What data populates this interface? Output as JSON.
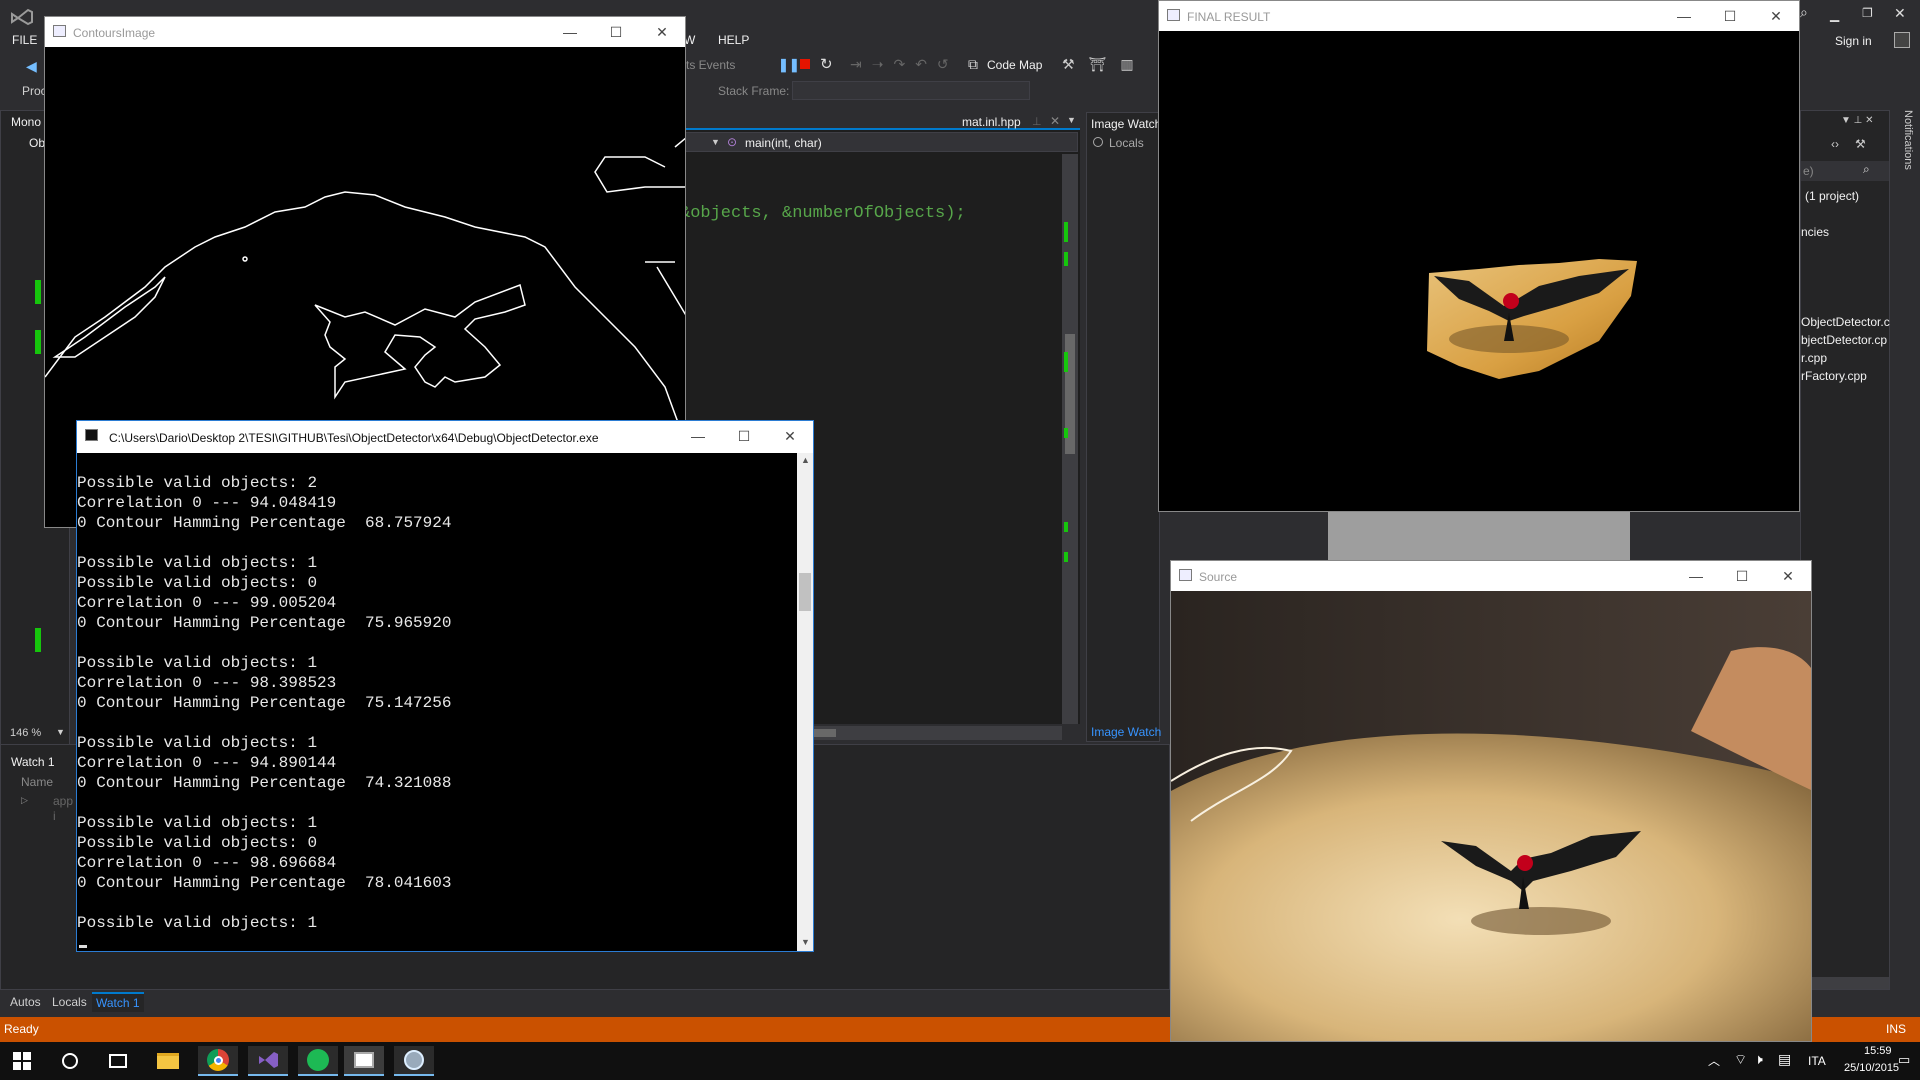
{
  "vs": {
    "menu": [
      "FILE",
      "W",
      "HELP"
    ],
    "toolbar": {
      "events": "ts Events",
      "code_map": "Code Map",
      "stack_frame_label": "Stack Frame:",
      "project_label": "Proc"
    },
    "left_panel": {
      "tab": "Mono",
      "item": "Ob",
      "zoom": "146 %"
    },
    "editor": {
      "tab": "mat.inl.hpp",
      "function_dropdown": "main(int, char)",
      "code_line": "&objects, &numberOfObjects);"
    },
    "image_watch": {
      "title": "Image Watch",
      "locals": "Locals",
      "bottom_tab": "Image Watch"
    },
    "watch": {
      "title": "Watch 1",
      "column_name": "Name",
      "row1": "app",
      "row2": "i"
    },
    "bottom_tabs": [
      "Autos",
      "Locals",
      "Watch 1"
    ],
    "solution": {
      "sign_in": "Sign in",
      "project_count": "(1 project)",
      "item_dependencies": "ncies",
      "files": [
        "ObjectDetector.c",
        "bjectDetector.cp",
        "r.cpp",
        "rFactory.cpp"
      ],
      "search_hint": "e)",
      "notifications": "Notifications"
    },
    "status": {
      "left": "Ready",
      "right": "INS"
    }
  },
  "windows": {
    "contours": {
      "title": "ContoursImage"
    },
    "final": {
      "title": "FINAL RESULT"
    },
    "source": {
      "title": "Source"
    },
    "console": {
      "title": "C:\\Users\\Dario\\Desktop 2\\TESI\\GITHUB\\Tesi\\ObjectDetector\\x64\\Debug\\ObjectDetector.exe",
      "lines": [
        "Possible valid objects: 2",
        "Correlation 0 --- 94.048419",
        "0 Contour Hamming Percentage  68.757924",
        "",
        "Possible valid objects: 1",
        "Possible valid objects: 0",
        "Correlation 0 --- 99.005204",
        "0 Contour Hamming Percentage  75.965920",
        "",
        "Possible valid objects: 1",
        "Correlation 0 --- 98.398523",
        "0 Contour Hamming Percentage  75.147256",
        "",
        "Possible valid objects: 1",
        "Correlation 0 --- 94.890144",
        "0 Contour Hamming Percentage  74.321088",
        "",
        "Possible valid objects: 1",
        "Possible valid objects: 0",
        "Correlation 0 --- 98.696684",
        "0 Contour Hamming Percentage  78.041603",
        "",
        "Possible valid objects: 1"
      ]
    }
  },
  "taskbar": {
    "lang": "ITA",
    "time": "15:59",
    "date": "25/10/2015"
  },
  "colors": {
    "status_bar": "#ca5100",
    "accent": "#2b7cd3",
    "vs_bg": "#2d2d30"
  }
}
